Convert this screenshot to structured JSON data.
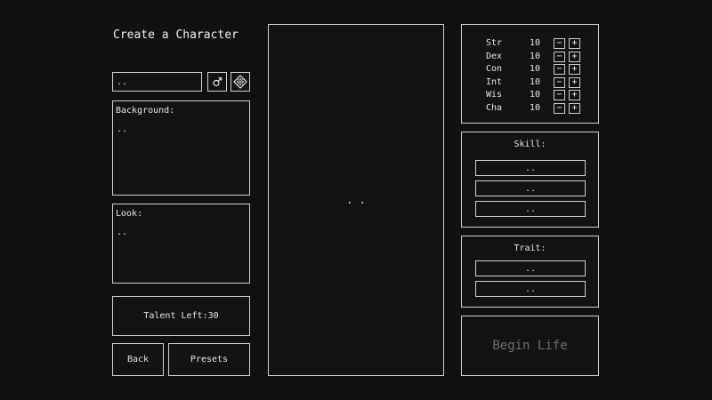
{
  "title": "Create a Character",
  "name_field": {
    "value": ".."
  },
  "icons": {
    "gender": "male-symbol-icon",
    "randomize": "dice-icon"
  },
  "background": {
    "label": "Background:",
    "text": ".."
  },
  "look": {
    "label": "Look:",
    "text": ".."
  },
  "talent": {
    "label": "Talent Left:30"
  },
  "buttons": {
    "back": "Back",
    "presets": "Presets",
    "begin": "Begin Life"
  },
  "preview": {
    "text": ". ."
  },
  "stats": [
    {
      "name": "Str",
      "value": "10"
    },
    {
      "name": "Dex",
      "value": "10"
    },
    {
      "name": "Con",
      "value": "10"
    },
    {
      "name": "Int",
      "value": "10"
    },
    {
      "name": "Wis",
      "value": "10"
    },
    {
      "name": "Cha",
      "value": "10"
    }
  ],
  "stat_controls": {
    "minus": "−",
    "plus": "+"
  },
  "skill": {
    "heading": "Skill:",
    "slots": [
      "..",
      "..",
      ".."
    ]
  },
  "trait": {
    "heading": "Trait:",
    "slots": [
      "..",
      ".."
    ]
  },
  "colors": {
    "background": "#121111",
    "border": "#cfcfcf",
    "text": "#e6e6e6",
    "disabled": "#6d6d6d"
  }
}
